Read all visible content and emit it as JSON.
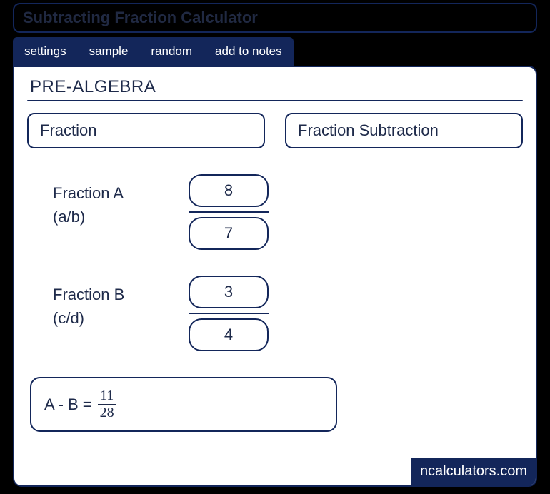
{
  "title": "Subtracting Fraction Calculator",
  "tabs": {
    "settings": "settings",
    "sample": "sample",
    "random": "random",
    "add_notes": "add to notes"
  },
  "subject": "PRE-ALGEBRA",
  "crumbs": {
    "left": "Fraction",
    "right": "Fraction Subtraction"
  },
  "inputs": {
    "a": {
      "label": "Fraction A",
      "hint": "(a/b)",
      "num": "8",
      "den": "7"
    },
    "b": {
      "label": "Fraction B",
      "hint": "(c/d)",
      "num": "3",
      "den": "4"
    }
  },
  "result": {
    "label": "A - B  = ",
    "num": "11",
    "den": "28"
  },
  "brand": "ncalculators.com"
}
